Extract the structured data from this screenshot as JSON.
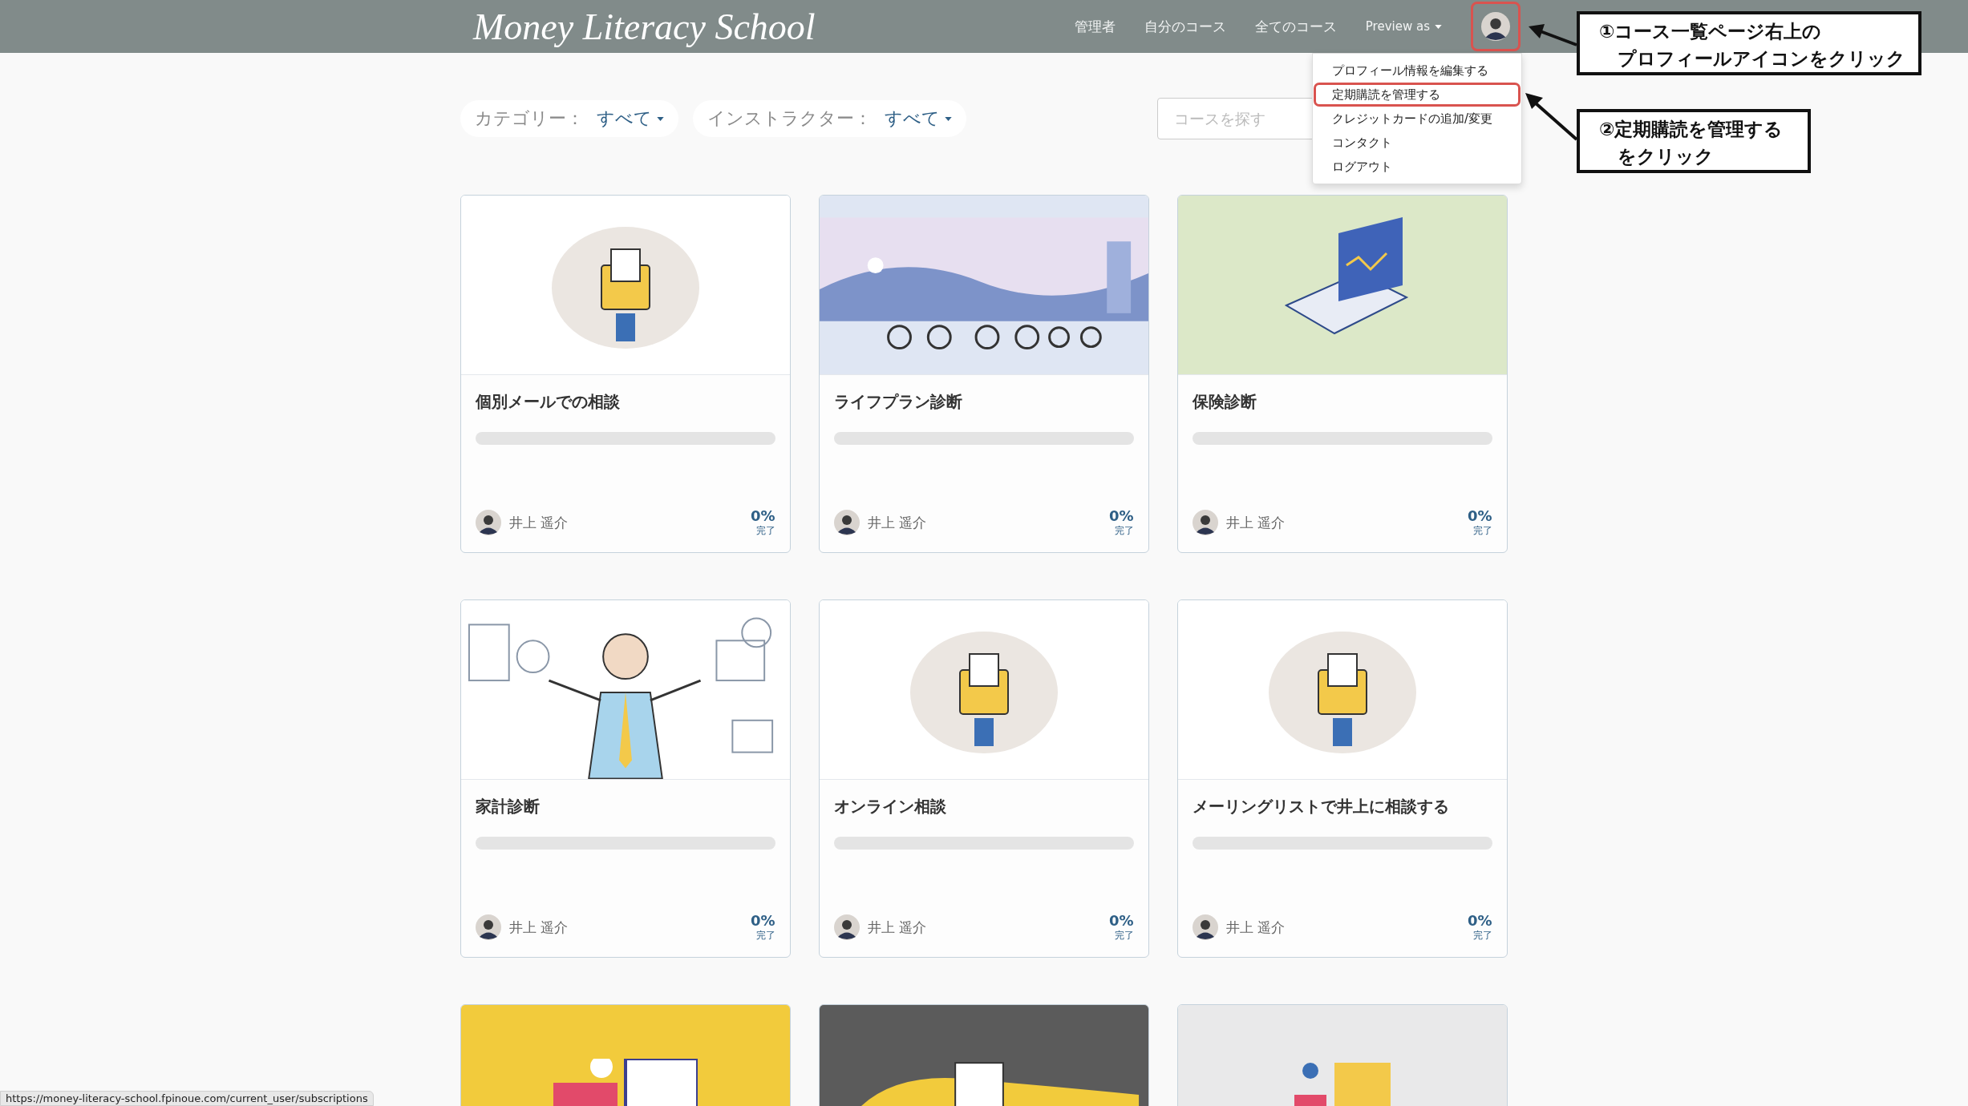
{
  "header": {
    "logo": "Money Literacy School",
    "nav": [
      {
        "label": "管理者",
        "kind": "link"
      },
      {
        "label": "自分のコース",
        "kind": "link"
      },
      {
        "label": "全てのコース",
        "kind": "link"
      },
      {
        "label": "Preview as",
        "kind": "dropdown"
      }
    ],
    "avatar": {
      "highlighted": true
    }
  },
  "profile_menu": {
    "items": [
      {
        "label": "プロフィール情報を編集する",
        "highlighted": false
      },
      {
        "label": "定期購読を管理する",
        "highlighted": true
      },
      {
        "label": "クレジットカードの追加/変更",
        "highlighted": false
      },
      {
        "label": "コンタクト",
        "highlighted": false
      },
      {
        "label": "ログアウト",
        "highlighted": false
      }
    ]
  },
  "filters": [
    {
      "label": "カテゴリー：",
      "value": "すべて"
    },
    {
      "label": "インストラクター：",
      "value": "すべて"
    }
  ],
  "search": {
    "placeholder": "コースを探す"
  },
  "courses": [
    {
      "title": "個別メールでの相談",
      "kind": "blob",
      "level": 0,
      "instructor": "井上 遥介",
      "percent": "0%",
      "status": "完了"
    },
    {
      "title": "ライフプラン診断",
      "kind": "sky",
      "level": 0,
      "instructor": "井上 遥介",
      "percent": "0%",
      "status": "完了"
    },
    {
      "title": "保険診断",
      "kind": "green",
      "level": 0,
      "instructor": "井上 遥介",
      "percent": "0%",
      "status": "完了"
    },
    {
      "title": "家計診断",
      "kind": "white",
      "level": 0,
      "instructor": "井上 遥介",
      "percent": "0%",
      "status": "完了"
    },
    {
      "title": "オンライン相談",
      "kind": "blob",
      "level": 0,
      "instructor": "井上 遥介",
      "percent": "0%",
      "status": "完了"
    },
    {
      "title": "メーリングリストで井上に相談する",
      "kind": "blob",
      "level": 0,
      "instructor": "井上 遥介",
      "percent": "0%",
      "status": "完了"
    },
    {
      "kind": "yellow"
    },
    {
      "kind": "dark"
    },
    {
      "kind": "grey"
    }
  ],
  "annotations": [
    {
      "lines": [
        "①コース一覧ページ右上の",
        "　プロフィールアイコンをクリック"
      ]
    },
    {
      "lines": [
        "②定期購読を管理する",
        "　をクリック"
      ]
    }
  ],
  "status_bar": "https://money-literacy-school.fpinoue.com/current_user/subscriptions"
}
